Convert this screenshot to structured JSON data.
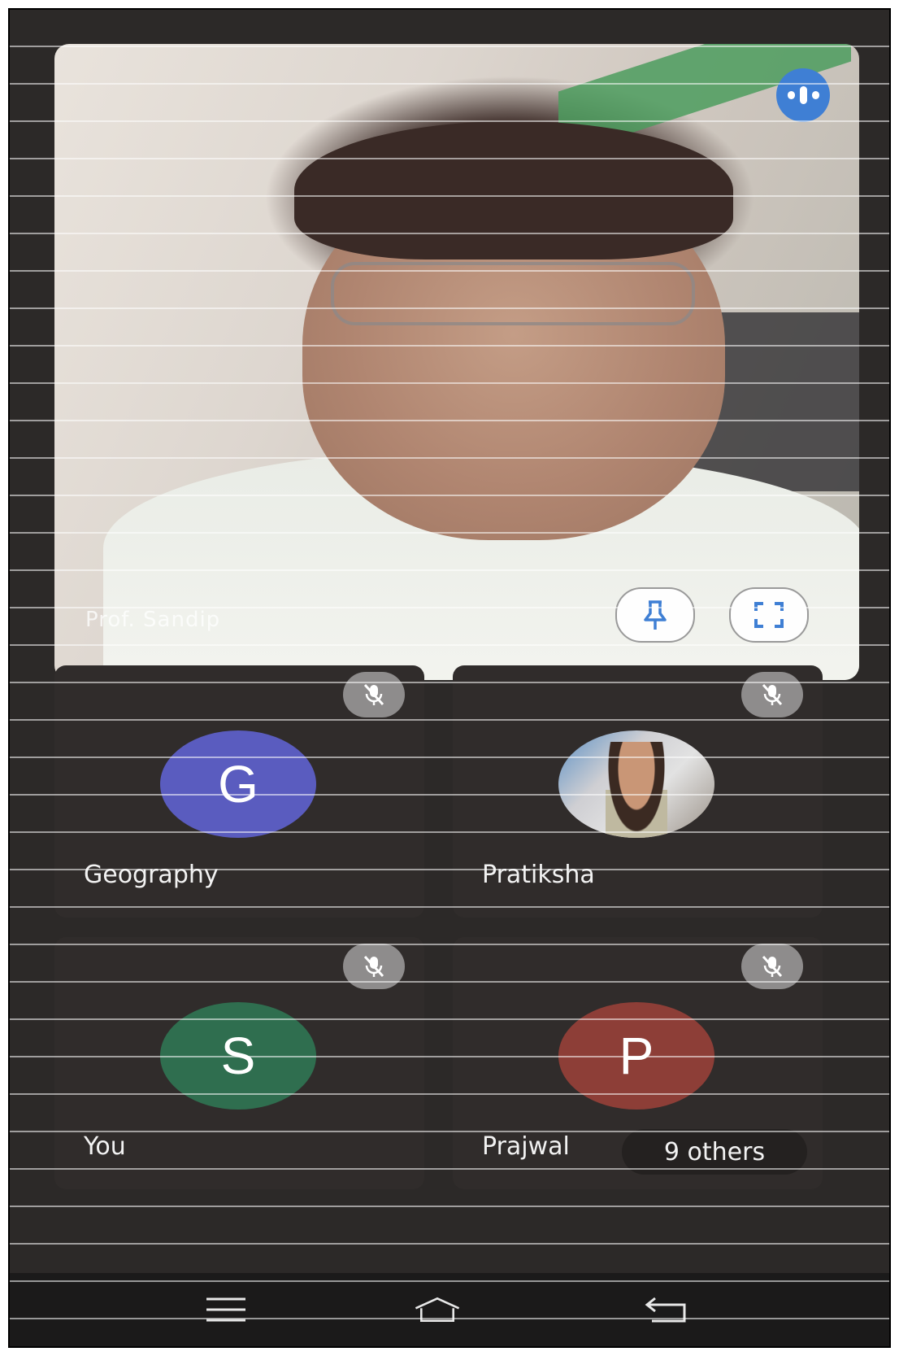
{
  "main_speaker": {
    "name": "Prof. Sandip",
    "speaking_indicator_icon": "audio-level-icon",
    "pin_icon": "pin-icon",
    "fullscreen_icon": "fullscreen-icon"
  },
  "participants": [
    {
      "name": "Geography",
      "initial": "G",
      "avatar_color": "#5a5cbf",
      "muted": true,
      "mic_icon": "mic-off-icon"
    },
    {
      "name": "Pratiksha",
      "initial": "",
      "avatar_type": "photo",
      "muted": true,
      "mic_icon": "mic-off-icon"
    },
    {
      "name": "You",
      "initial": "S",
      "avatar_color": "#2f6e4f",
      "muted": true,
      "mic_icon": "mic-off-icon"
    },
    {
      "name": "Prajwal",
      "initial": "P",
      "avatar_color": "#8d3e37",
      "muted": true,
      "mic_icon": "mic-off-icon"
    }
  ],
  "others_label": "9 others",
  "nav": {
    "menu_icon": "menu-icon",
    "home_icon": "home-icon",
    "back_icon": "back-icon"
  },
  "colors": {
    "background": "#2c2928",
    "accent": "#3f7fd4",
    "tile": "#302c2b"
  }
}
